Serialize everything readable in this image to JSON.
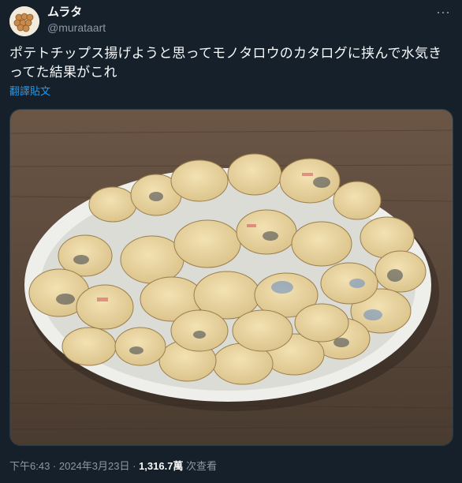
{
  "author": {
    "display_name": "ムラタ",
    "handle": "@murataart"
  },
  "tweet": {
    "text": "ポテトチップス揚げようと思ってモノタロウのカタログに挟んで水気きってた結果がこれ",
    "translate_label": "翻譯貼文"
  },
  "meta": {
    "time": "下午6:43",
    "sep1": " · ",
    "date": "2024年3月23日",
    "sep2": " · ",
    "views_count": "1,316.7萬",
    "views_label": " 次查看"
  },
  "icons": {
    "more": "more-horizontal-icon"
  },
  "colors": {
    "background": "#15202b",
    "text": "#f7f9f9",
    "secondary": "#8b98a5",
    "link": "#1d9bf0"
  }
}
